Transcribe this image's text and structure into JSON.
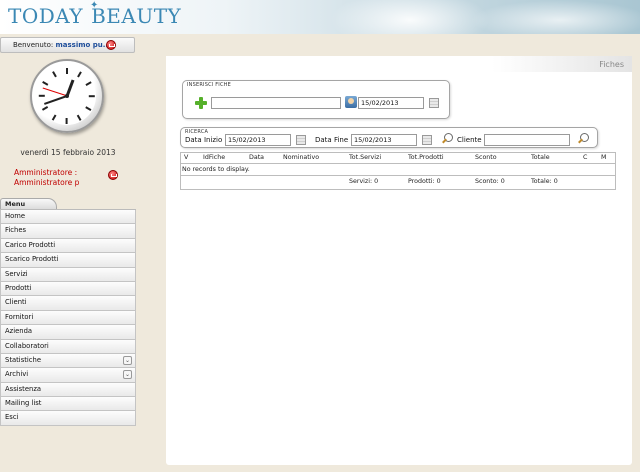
{
  "app": {
    "logo_word1": "TODAY",
    "logo_word2": "BEAUTY"
  },
  "welcome": {
    "label": "Benvenuto: ",
    "user": "massimo pu..."
  },
  "clock": {
    "time": "12:41:48"
  },
  "date_text": "venerdì 15 febbraio 2013",
  "role": {
    "line1": "Amministratore :",
    "line2": "Amministratore p"
  },
  "menu": {
    "tab_label": "Menu",
    "items": [
      {
        "label": "Home"
      },
      {
        "label": "Fiches"
      },
      {
        "label": "Carico Prodotti"
      },
      {
        "label": "Scarico Prodotti"
      },
      {
        "label": "Servizi"
      },
      {
        "label": "Prodotti"
      },
      {
        "label": "Clienti"
      },
      {
        "label": "Fornitori"
      },
      {
        "label": "Azienda"
      },
      {
        "label": "Collaboratori"
      },
      {
        "label": "Statistiche",
        "expandable": true
      },
      {
        "label": "Archivi",
        "expandable": true
      },
      {
        "label": "Assistenza"
      },
      {
        "label": "Mailing list"
      },
      {
        "label": "Esci"
      }
    ],
    "chevron_glyph": "⌄"
  },
  "page": {
    "title": "Fiches"
  },
  "inserisci": {
    "legend": "INSERISCI FICHE",
    "text_value": "",
    "date_value": "15/02/2013"
  },
  "ricerca": {
    "legend": "RICERCA",
    "data_inizio_label": "Data Inizio",
    "data_inizio_value": "15/02/2013",
    "data_fine_label": "Data Fine",
    "data_fine_value": "15/02/2013",
    "cliente_label": "Cliente",
    "cliente_value": ""
  },
  "grid": {
    "columns": [
      "V",
      "IdFiche",
      "Data",
      "Nominativo",
      "Tot.Servizi",
      "Tot.Prodotti",
      "Sconto",
      "Totale",
      "C",
      "M"
    ],
    "empty_message": "No records to display.",
    "footer": {
      "servizi": "Servizi: 0",
      "prodotti": "Prodotti: 0",
      "sconto": "Sconto: 0",
      "totale": "Totale: 0"
    }
  },
  "colors": {
    "logo": "#3b88b4",
    "role_text": "#c00000",
    "user_text": "#1f4e9a",
    "add_icon": "#56b02a"
  }
}
